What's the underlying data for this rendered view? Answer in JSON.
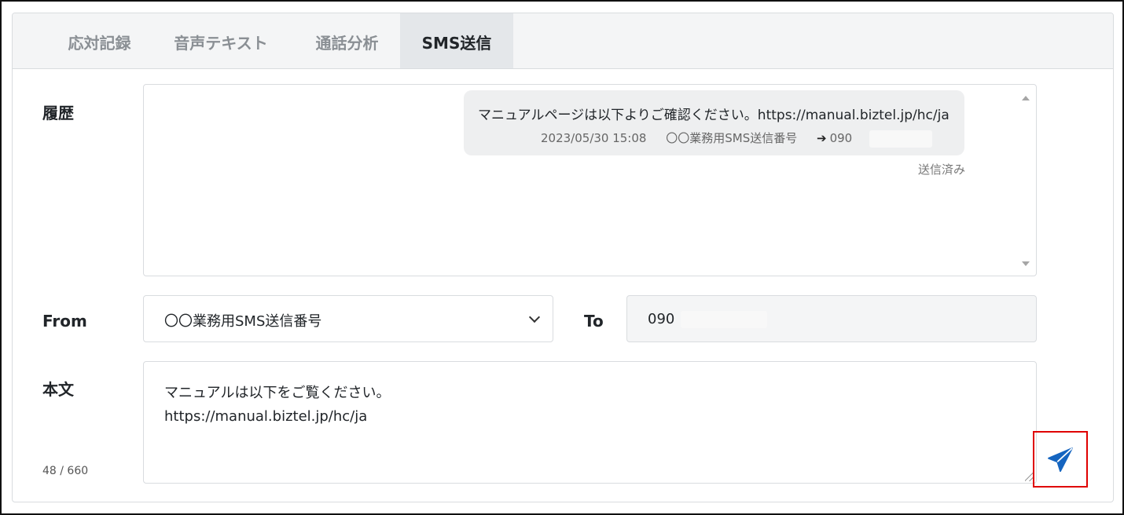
{
  "tabs": [
    {
      "label": "応対記録",
      "active": false
    },
    {
      "label": "音声テキスト",
      "active": false
    },
    {
      "label": "通話分析",
      "active": false
    },
    {
      "label": "SMS送信",
      "active": true
    }
  ],
  "labels": {
    "history": "履歴",
    "from": "From",
    "to": "To",
    "body": "本文"
  },
  "history": {
    "message": "マニュアルページは以下よりご確認ください。https://manual.biztel.jp/hc/ja",
    "timestamp": "2023/05/30 15:08",
    "sender": "〇〇業務用SMS送信番号",
    "recipient_prefix": "090",
    "status": "送信済み"
  },
  "from_select": {
    "value": "〇〇業務用SMS送信番号"
  },
  "to_field": {
    "value": "090"
  },
  "body": {
    "line1": "マニュアルは以下をご覧ください。",
    "line2": "https://manual.biztel.jp/hc/ja",
    "counter": "48 / 660"
  },
  "icons": {
    "send": "send-icon",
    "arrow": "arrow-right-icon",
    "chevron": "chevron-down-icon"
  },
  "colors": {
    "send_icon": "#1565c0",
    "highlight_box": "#e00000"
  }
}
